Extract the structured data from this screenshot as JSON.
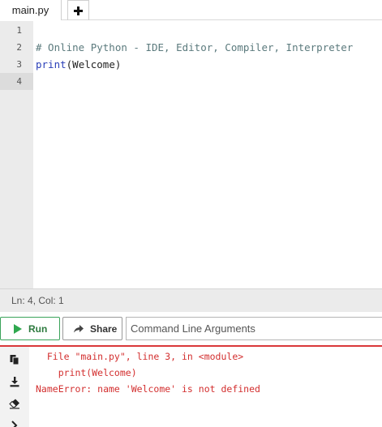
{
  "tabs": {
    "file_label": "main.py",
    "add_icon": "plus-icon"
  },
  "editor": {
    "line_numbers": [
      "1",
      "2",
      "3",
      "4"
    ],
    "active_line": "4",
    "lines": {
      "comment": "# Online Python - IDE, Editor, Compiler, Interpreter",
      "print_fn": "print",
      "print_open": "(",
      "print_arg": "Welcome",
      "print_close": ")"
    }
  },
  "status": {
    "position": "Ln: 4,  Col: 1"
  },
  "toolbar": {
    "run_label": "Run",
    "share_label": "Share",
    "args_placeholder": "Command Line Arguments",
    "args_value": ""
  },
  "output": {
    "lines": [
      "  File \"main.py\", line 3, in <module>",
      "    print(Welcome)",
      "NameError: name 'Welcome' is not defined"
    ],
    "side_icons": [
      "copy-icon",
      "download-icon",
      "eraser-icon",
      "chevron-right-icon"
    ]
  },
  "colors": {
    "error_text": "#d32f2f",
    "run_border": "#3aa35a",
    "run_icon": "#2fa84f",
    "output_border": "#d9383a"
  }
}
